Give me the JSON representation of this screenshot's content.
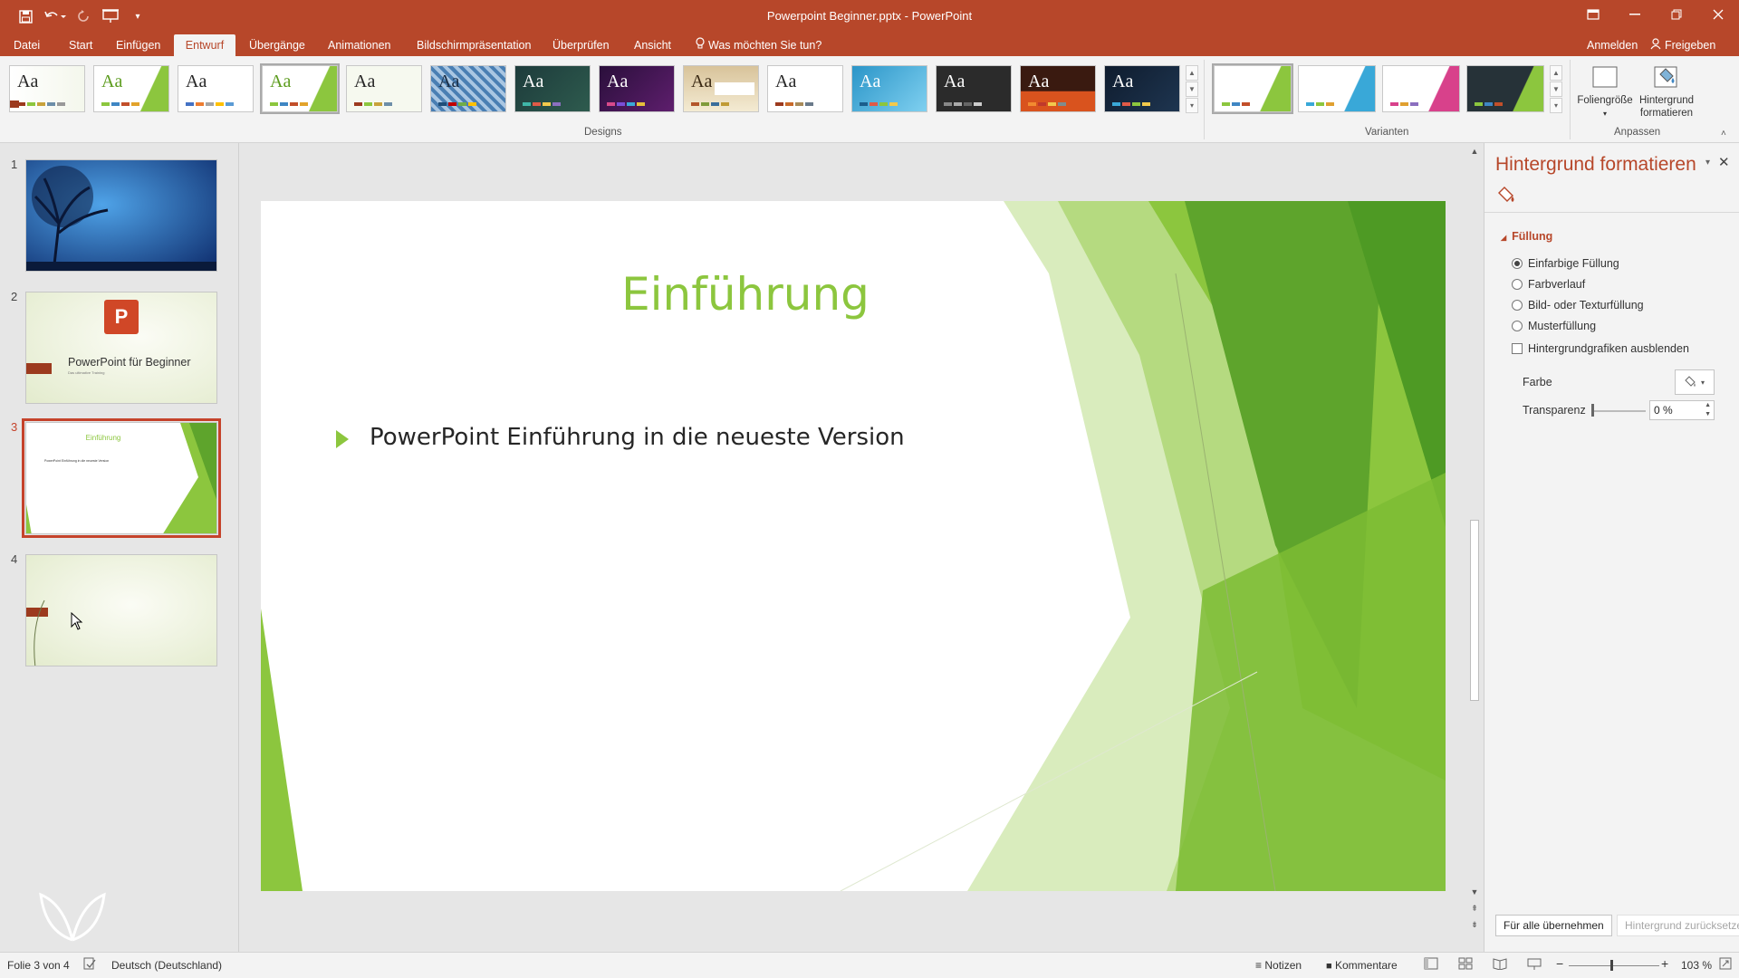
{
  "window": {
    "title": "Powerpoint Beginner.pptx - PowerPoint",
    "accent": "#b7472a"
  },
  "qat": {
    "save_icon": "save-icon",
    "undo_icon": "undo-icon",
    "redo_icon": "redo-icon",
    "present_icon": "present-from-start-icon",
    "customize_icon": "customize-qat-icon"
  },
  "tabs": [
    {
      "label": "Datei"
    },
    {
      "label": "Start"
    },
    {
      "label": "Einfügen"
    },
    {
      "label": "Entwurf",
      "active": true
    },
    {
      "label": "Übergänge"
    },
    {
      "label": "Animationen"
    },
    {
      "label": "Bildschirmpräsentation"
    },
    {
      "label": "Überprüfen"
    },
    {
      "label": "Ansicht"
    }
  ],
  "tell_me": "Was möchten Sie tun?",
  "signin": "Anmelden",
  "share": "Freigeben",
  "ribbon": {
    "groups": {
      "designs": "Designs",
      "variants": "Varianten",
      "customize": "Anpassen"
    },
    "theme_sample_text": "Aa",
    "customize_buttons": {
      "slide_size": "Foliengröße",
      "format_background_line1": "Hintergrund",
      "format_background_line2": "formatieren"
    }
  },
  "slides": [
    {
      "number": "1"
    },
    {
      "number": "2",
      "title": "PowerPoint für Beginner",
      "subtitle": "Das ultimative Training"
    },
    {
      "number": "3",
      "title": "Einführung",
      "bullet": "PowerPoint Einführung in die neueste Version"
    },
    {
      "number": "4"
    }
  ],
  "current_slide": {
    "title": "Einführung",
    "bullet": "PowerPoint Einführung in die neueste Version",
    "title_color": "#8cc63e"
  },
  "format_pane": {
    "title": "Hintergrund formatieren",
    "section": "Füllung",
    "options": [
      {
        "label": "Einfarbige Füllung",
        "selected": true
      },
      {
        "label": "Farbverlauf",
        "selected": false
      },
      {
        "label": "Bild- oder Texturfüllung",
        "selected": false
      },
      {
        "label": "Musterfüllung",
        "selected": false
      }
    ],
    "hide_graphics": "Hintergrundgrafiken ausblenden",
    "color_label": "Farbe",
    "transparency_label": "Transparenz",
    "transparency_value": "0 %",
    "apply_all": "Für alle übernehmen",
    "reset": "Hintergrund zurücksetzen"
  },
  "status": {
    "slide_of": "Folie 3 von 4",
    "language": "Deutsch (Deutschland)",
    "notes": "Notizen",
    "comments": "Kommentare",
    "zoom": "103 %"
  }
}
